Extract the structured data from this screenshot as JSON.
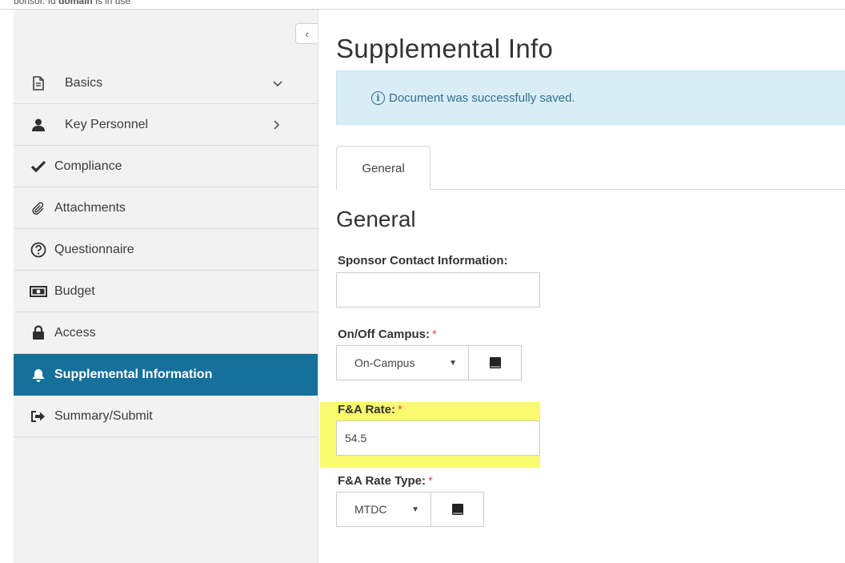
{
  "top_clip": {
    "prefix": "bonsor. Id",
    "bold": "domain",
    "suffix": "is in use"
  },
  "sidebar": {
    "collapse_glyph": "‹",
    "items": [
      {
        "label": "Basics",
        "icon": "document-icon",
        "chevron": "⌵",
        "active": false
      },
      {
        "label": "Key Personnel",
        "icon": "user-icon",
        "chevron": "›",
        "active": false
      },
      {
        "label": "Compliance",
        "icon": "checkmark-icon",
        "active": false
      },
      {
        "label": "Attachments",
        "icon": "paperclip-icon",
        "active": false
      },
      {
        "label": "Questionnaire",
        "icon": "question-circle-icon",
        "active": false
      },
      {
        "label": "Budget",
        "icon": "money-icon",
        "active": false
      },
      {
        "label": "Access",
        "icon": "lock-icon",
        "active": false
      },
      {
        "label": "Supplemental Information",
        "icon": "bell-icon",
        "active": true
      },
      {
        "label": "Summary/Submit",
        "icon": "sign-out-icon",
        "active": false
      }
    ],
    "active_color": "#15709b"
  },
  "main": {
    "title": "Supplemental Info",
    "alert": {
      "icon_glyph": "i",
      "text": "Document was successfully saved."
    },
    "tabs": [
      {
        "label": "General"
      }
    ],
    "section_title": "General",
    "fields": {
      "sponsor_contact": {
        "label": "Sponsor Contact Information:",
        "value": ""
      },
      "on_off_campus": {
        "label": "On/Off Campus:",
        "required": "*",
        "value": "On-Campus",
        "arrow": "▼"
      },
      "fa_rate": {
        "label": "F&A Rate:",
        "required": "*",
        "value": "54.5"
      },
      "fa_rate_type": {
        "label": "F&A Rate Type:",
        "required": "*",
        "value": "MTDC",
        "arrow": "▼"
      }
    },
    "highlight_color": "#fafa6e"
  }
}
